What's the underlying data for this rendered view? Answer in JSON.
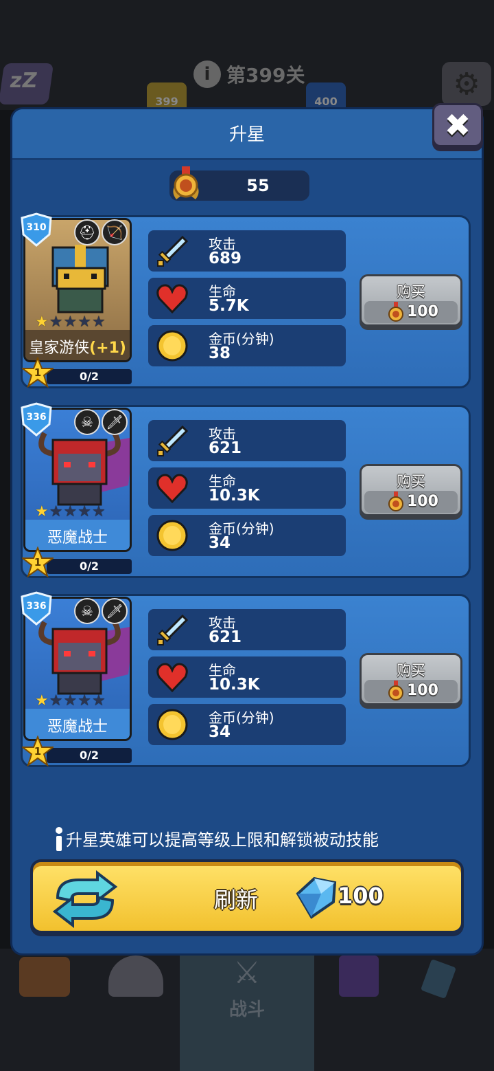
{
  "background": {
    "sleep_icon": "zzz-icon",
    "level_label": "第399关",
    "badge_left": "399",
    "badge_right": "400",
    "battle_tab_label": "战斗"
  },
  "modal": {
    "title": "升星",
    "close_icon": "close-icon"
  },
  "currency": {
    "icon": "medal-icon",
    "amount": "55"
  },
  "heroes": [
    {
      "level": "310",
      "name": "皇家游侠",
      "bonus": "(+1)",
      "stars_filled": 1,
      "stars_total": 5,
      "star_rank": "1",
      "progress": "0/2",
      "role_icons": [
        "helmet-icon",
        "bow-icon"
      ],
      "attack_label": "攻击",
      "attack_value": "689",
      "hp_label": "生命",
      "hp_value": "5.7K",
      "gold_label": "金币(分钟)",
      "gold_value": "38",
      "buy_label": "购买",
      "buy_price": "100",
      "theme": "gold"
    },
    {
      "level": "336",
      "name": "恶魔战士",
      "bonus": "",
      "stars_filled": 1,
      "stars_total": 5,
      "star_rank": "1",
      "progress": "0/2",
      "role_icons": [
        "skull-icon",
        "sword-icon"
      ],
      "attack_label": "攻击",
      "attack_value": "621",
      "hp_label": "生命",
      "hp_value": "10.3K",
      "gold_label": "金币(分钟)",
      "gold_value": "34",
      "buy_label": "购买",
      "buy_price": "100",
      "theme": "blue"
    },
    {
      "level": "336",
      "name": "恶魔战士",
      "bonus": "",
      "stars_filled": 1,
      "stars_total": 5,
      "star_rank": "1",
      "progress": "0/2",
      "role_icons": [
        "skull-icon",
        "sword-icon"
      ],
      "attack_label": "攻击",
      "attack_value": "621",
      "hp_label": "生命",
      "hp_value": "10.3K",
      "gold_label": "金币(分钟)",
      "gold_value": "34",
      "buy_label": "购买",
      "buy_price": "100",
      "theme": "blue"
    }
  ],
  "info_text": "升星英雄可以提高等级上限和解锁被动技能",
  "refresh": {
    "label": "刷新",
    "price": "100",
    "icon": "refresh-icon",
    "currency_icon": "gem-icon"
  },
  "colors": {
    "modal_bg": "#1d4a86",
    "card_bg": "#3b82d0",
    "refresh_yellow": "#f2c12e",
    "star_gold": "#ffd233"
  }
}
